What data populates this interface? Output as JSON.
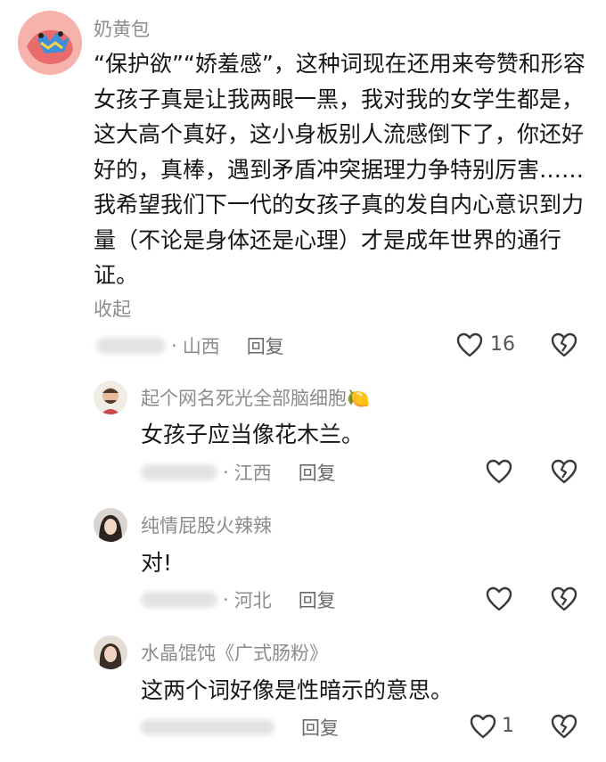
{
  "comments": [
    {
      "author": "奶黄包",
      "text": "“保护欲”“娇羞感”，这种词现在还用来夸赞和形容女孩子真是让我两眼一黑，我对我的女学生都是，这大高个真好，这小身板别人流感倒下了，你还好好的，真棒，遇到矛盾冲突据理力争特别厉害……我希望我们下一代的女孩子真的发自内心意识到力量（不论是身体还是心理）才是成年世界的通行证。",
      "collapse_label": "收起",
      "location": "山西",
      "reply_label": "回复",
      "like_count": "16"
    },
    {
      "author": "起个网名死光全部脑细胞",
      "author_emoji": "🍋",
      "text": "女孩子应当像花木兰。",
      "location": "江西",
      "reply_label": "回复"
    },
    {
      "author": "纯情屁股火辣辣",
      "text": "对!",
      "location": "河北",
      "reply_label": "回复"
    },
    {
      "author": "水晶馄饨《广式肠粉》",
      "text": "这两个词好像是性暗示的意思。",
      "reply_label": "回复",
      "like_count": "1"
    }
  ],
  "icons": {
    "like": "heart-outline-icon",
    "dislike": "broken-heart-icon"
  },
  "colors": {
    "name": "#8c8c8c",
    "text": "#161616",
    "icon": "#3a3a3a"
  }
}
